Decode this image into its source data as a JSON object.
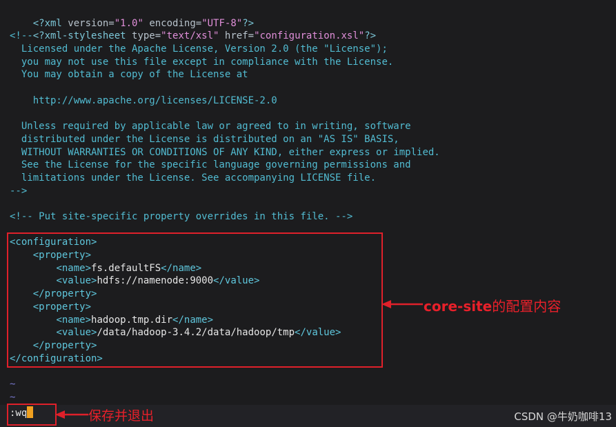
{
  "editor": {
    "lines": [
      {
        "kind": "pi1",
        "p1": "<?xml ",
        "a1": "version=",
        "s1": "\"1.0\"",
        "sp": " ",
        "a2": "encoding=",
        "s2": "\"UTF-8\"",
        "p2": "?>"
      },
      {
        "kind": "pi2",
        "p1": "<?xml-stylesheet ",
        "a1": "type=",
        "s1": "\"text/xsl\"",
        "sp": " ",
        "a2": "href=",
        "s2": "\"configuration.xsl\"",
        "p2": "?>"
      },
      {
        "kind": "comment",
        "text": "<!--"
      },
      {
        "kind": "comment",
        "text": "  Licensed under the Apache License, Version 2.0 (the \"License\");"
      },
      {
        "kind": "comment",
        "text": "  you may not use this file except in compliance with the License."
      },
      {
        "kind": "comment",
        "text": "  You may obtain a copy of the License at"
      },
      {
        "kind": "comment",
        "text": ""
      },
      {
        "kind": "comment",
        "text": "    http://www.apache.org/licenses/LICENSE-2.0"
      },
      {
        "kind": "comment",
        "text": ""
      },
      {
        "kind": "comment",
        "text": "  Unless required by applicable law or agreed to in writing, software"
      },
      {
        "kind": "comment",
        "text": "  distributed under the License is distributed on an \"AS IS\" BASIS,"
      },
      {
        "kind": "comment",
        "text": "  WITHOUT WARRANTIES OR CONDITIONS OF ANY KIND, either express or implied."
      },
      {
        "kind": "comment",
        "text": "  See the License for the specific language governing permissions and"
      },
      {
        "kind": "comment",
        "text": "  limitations under the License. See accompanying LICENSE file."
      },
      {
        "kind": "comment",
        "text": "-->"
      },
      {
        "kind": "comment",
        "text": ""
      },
      {
        "kind": "comment",
        "text": "<!-- Put site-specific property overrides in this file. -->"
      },
      {
        "kind": "comment",
        "text": ""
      },
      {
        "kind": "tag",
        "indent": "",
        "open": "<configuration>",
        "value": "",
        "close": ""
      },
      {
        "kind": "tag",
        "indent": "    ",
        "open": "<property>",
        "value": "",
        "close": ""
      },
      {
        "kind": "tag",
        "indent": "        ",
        "open": "<name>",
        "value": "fs.defaultFS",
        "close": "</name>"
      },
      {
        "kind": "tag",
        "indent": "        ",
        "open": "<value>",
        "value": "hdfs://namenode:9000",
        "close": "</value>"
      },
      {
        "kind": "tag",
        "indent": "    ",
        "open": "</property>",
        "value": "",
        "close": ""
      },
      {
        "kind": "tag",
        "indent": "    ",
        "open": "<property>",
        "value": "",
        "close": ""
      },
      {
        "kind": "tag",
        "indent": "        ",
        "open": "<name>",
        "value": "hadoop.tmp.dir",
        "close": "</name>"
      },
      {
        "kind": "tag",
        "indent": "        ",
        "open": "<value>",
        "value": "/data/hadoop-3.4.2/data/hadoop/tmp",
        "close": "</value>"
      },
      {
        "kind": "tag",
        "indent": "    ",
        "open": "</property>",
        "value": "",
        "close": ""
      },
      {
        "kind": "tag",
        "indent": "",
        "open": "</configuration>",
        "value": "",
        "close": ""
      },
      {
        "kind": "comment",
        "text": ""
      },
      {
        "kind": "tilde",
        "text": "~"
      },
      {
        "kind": "tilde",
        "text": "~"
      }
    ]
  },
  "command_line": {
    "text": ":wq"
  },
  "annotations": {
    "config_prefix": "core-site",
    "config_suffix": "的配置内容",
    "save_quit": "保存并退出"
  },
  "watermark": "CSDN @牛奶咖啡13",
  "colors": {
    "highlight": "#e0202a",
    "cursor": "#f0a020",
    "background": "#1c1c1e"
  }
}
